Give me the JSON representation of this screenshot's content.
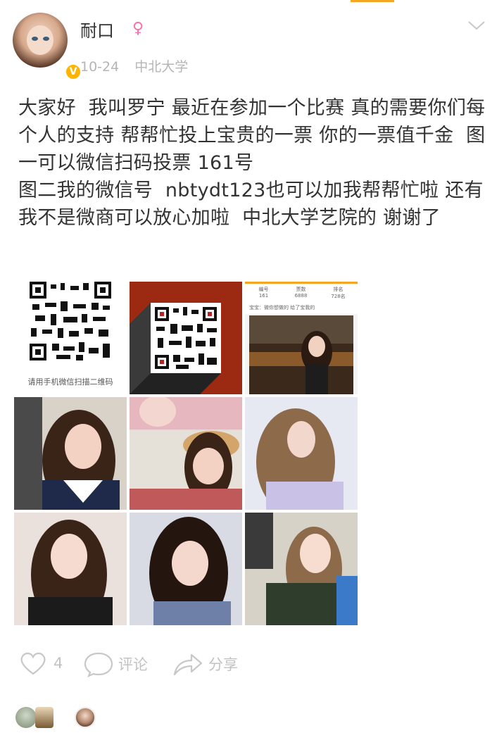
{
  "post": {
    "username": "耐口",
    "gender_symbol": "♀",
    "verified_badge": "V",
    "date": "10-24",
    "school": "中北大学",
    "text": "大家好  我叫罗宁 最近在参加一个比赛 真的需要你们每个人的支持 帮帮忙投上宝贵的一票 你的一票值千金  图一可以微信扫码投票 161号\n图二我的微信号  nbtydt123也可以加我帮帮忙啦 还有我不是微商可以放心加啦  中北大学艺院的 谢谢了"
  },
  "images": {
    "qr_caption": "请用手机微信扫描二维码",
    "vote_stats": [
      "编号",
      "票数",
      "排名",
      "161",
      "6888",
      "728名"
    ],
    "vote_notice": "宝宝：微你想做的 给了宝我的"
  },
  "actions": {
    "likes": "4",
    "comment": "评论",
    "share": "分享"
  },
  "colors": {
    "accent": "#f5a623",
    "gender": "#ff6fa8",
    "muted": "#b5b5b5",
    "icon": "#c8c8c8"
  },
  "icons": [
    "chevron-down-icon",
    "heart-icon",
    "comment-icon",
    "share-icon",
    "verified-icon"
  ]
}
